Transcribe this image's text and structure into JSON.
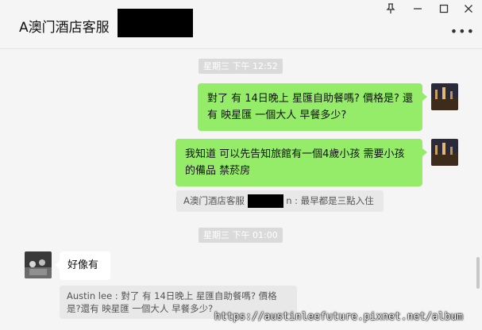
{
  "window": {
    "title": "A澳门酒店客服",
    "pin_icon": "pin-icon",
    "minimize_icon": "minimize-icon",
    "maximize_icon": "maximize-icon",
    "close_icon": "close-icon",
    "more_icon": "more-icon"
  },
  "messages": {
    "ts1": "星期三 下午 12:52",
    "msg1": "對了 有 14日晚上  星匯自助餐嗎?  價格是? 還有 映星匯 一個大人  早餐多少?",
    "msg2": "我知道  可以先告知旅館有一個4歲小孩  需要小孩的備品  禁菸房",
    "quote1_prefix": "A澳门酒店客服",
    "quote1_suffix": "n : 最早都是三點入住",
    "ts2": "星期三 下午 01:00",
    "msg3": "好像有",
    "quote2": "Austin lee : 對了 有 14日晚上  星匯自助餐嗎?  價格是?還有 映星匯 一個大人  早餐多少?"
  },
  "watermark": "https://austinleefuture.pixnet.net/album"
}
